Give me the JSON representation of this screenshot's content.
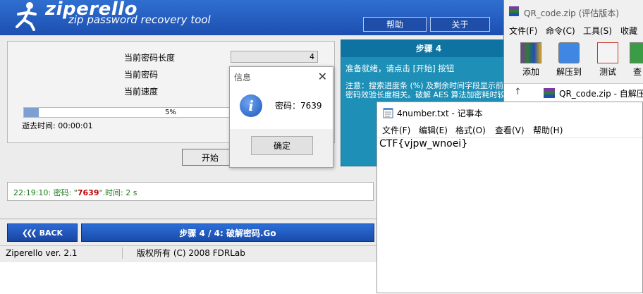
{
  "ziperello": {
    "logo_title": "ziperello",
    "logo_subtitle": "zip password recovery tool",
    "header_buttons": [
      "帮助",
      "关于"
    ],
    "stats": {
      "length_label": "当前密码长度",
      "length_value": "4",
      "password_label": "当前密码",
      "speed_label": "当前速度"
    },
    "progress": {
      "percent_text": "5%",
      "fraction": 0.05
    },
    "elapsed": "逝去时间: 00:00:01",
    "start_button": "开始",
    "step_panel": {
      "title": "步骤 4",
      "line1": "准备就绪，请点击 [开始] 按钮",
      "line2": "注意：搜索进度条 (%) 及剩余时间字段显示前的密码效验长度相关。破解 AES 算法加密耗时较长"
    },
    "log": {
      "prefix": "22:19:10: 密码: \"",
      "password": "7639",
      "suffix": "\".时间: 2 s"
    },
    "back_button": "BACK",
    "step_bar": "步骤 4 / 4: 破解密码.Go",
    "status": {
      "version": "Ziperello ver. 2.1",
      "copyright": "版权所有 (C) 2008 FDRLab"
    }
  },
  "info_dialog": {
    "title": "信息",
    "close": "✕",
    "icon": "information-icon",
    "message": "密码：7639",
    "ok": "确定"
  },
  "winrar": {
    "title": "QR_code.zip (评估版本)",
    "menu": [
      "文件(F)",
      "命令(C)",
      "工具(S)",
      "收藏"
    ],
    "tools": [
      "添加",
      "解压到",
      "测试",
      "查"
    ],
    "path": "QR_code.zip - 自解压"
  },
  "notepad": {
    "title": "4number.txt - 记事本",
    "menu": [
      "文件(F)",
      "编辑(E)",
      "格式(O)",
      "查看(V)",
      "帮助(H)"
    ],
    "content": "CTF{vjpw_wnoei}"
  },
  "colors": {
    "header_blue": "#1d4fb0",
    "step_panel": "#1e90b8",
    "log_green": "#1b7a1b",
    "log_password": "#c00000"
  }
}
